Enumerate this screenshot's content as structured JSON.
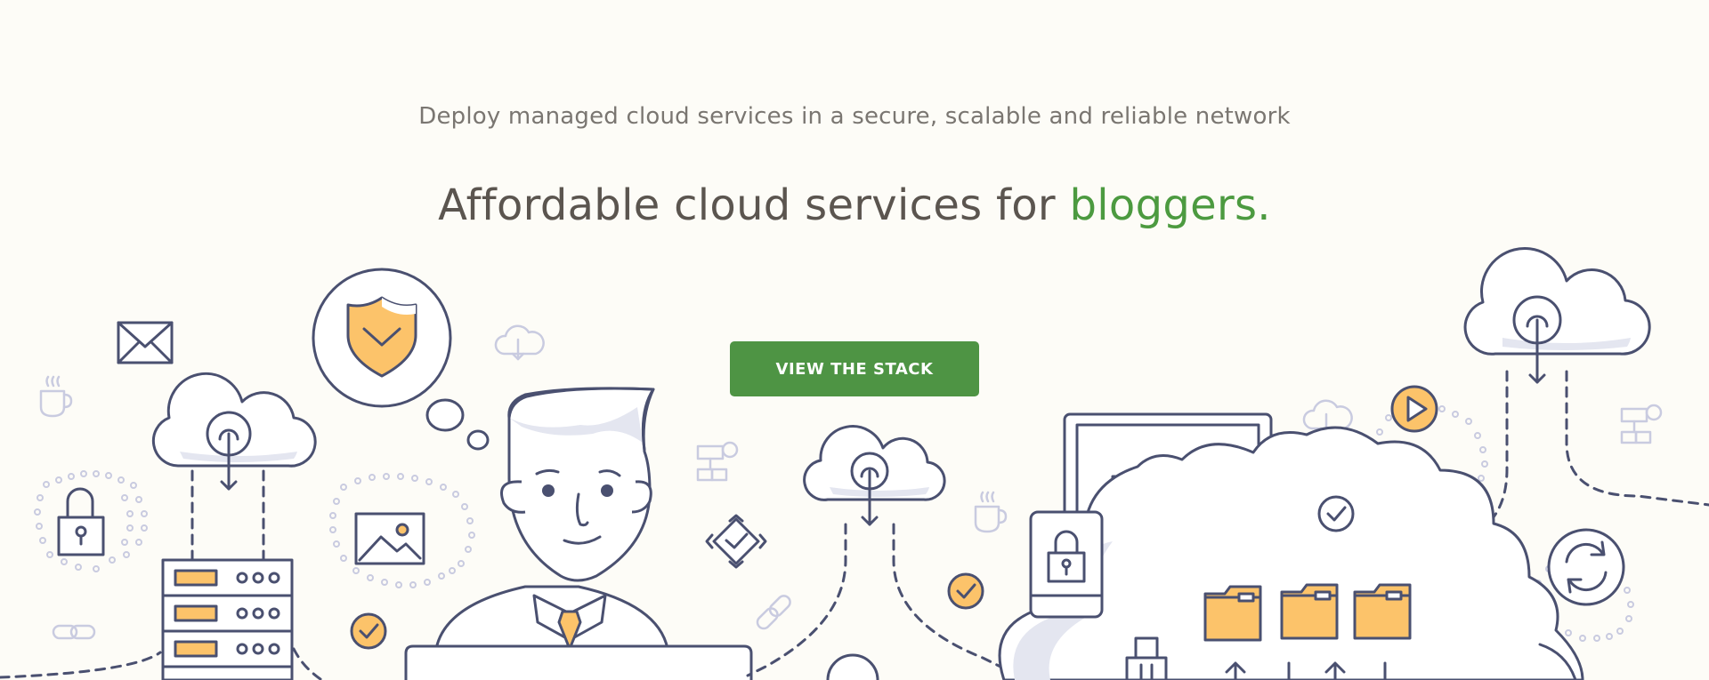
{
  "hero": {
    "tagline": "Deploy managed cloud services in a secure, scalable and reliable network",
    "headline_prefix": "Affordable cloud services for ",
    "headline_accent": "bloggers.",
    "cta_label": "VIEW THE STACK"
  },
  "colors": {
    "background": "#fdfcf7",
    "accent_green": "#4c9a40",
    "button_green": "#4e9444",
    "illustration_stroke": "#4a5070",
    "illustration_yellow": "#fcc36a"
  },
  "illustration": {
    "icons": [
      "envelope-icon",
      "coffee-cup-icon",
      "cloud-download-icon",
      "lock-icon",
      "chain-link-icon",
      "server-rack-icon",
      "checkmark-badge-icon",
      "shield-thought-bubble-icon",
      "image-frame-icon",
      "businessman-icon",
      "laptop-icon",
      "sitemap-icon",
      "diamond-check-icon",
      "play-button-icon",
      "monitor-chart-icon",
      "phone-lock-icon",
      "folder-icon",
      "refresh-icon",
      "usb-drive-icon"
    ]
  }
}
